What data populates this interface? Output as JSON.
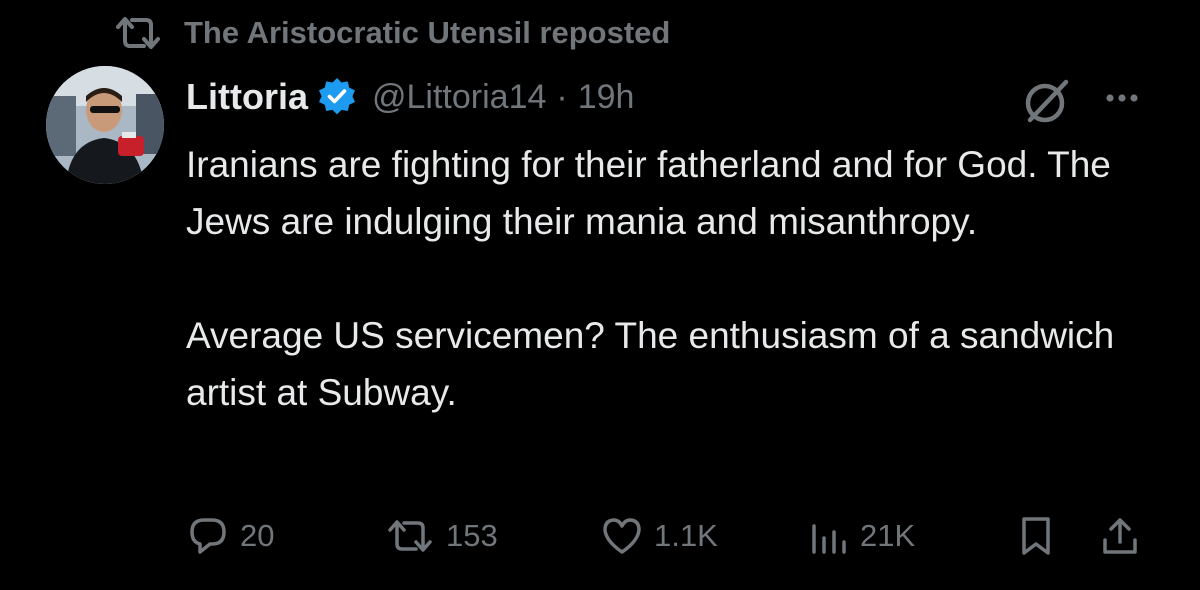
{
  "repost_banner": {
    "text": "The Aristocratic Utensil reposted",
    "icon": "repost-icon"
  },
  "tweet": {
    "author": {
      "display_name": "Littoria",
      "handle": "@Littoria14",
      "verified": true,
      "verified_color": "#1d9bf0",
      "avatar": "profile-photo"
    },
    "separator": "·",
    "time": "19h",
    "text": "Iranians are fighting for their fatherland and for God. The Jews are indulging their mania and misanthropy.\n\nAverage US servicemen? The enthusiasm of a sandwich artist at Subway.",
    "actions": {
      "replies": "20",
      "reposts": "153",
      "likes": "1.1K",
      "views": "21K"
    }
  },
  "colors": {
    "background": "#000000",
    "primary_text": "#e7e9ea",
    "secondary_text": "#71767b",
    "accent": "#1d9bf0"
  },
  "icons": [
    "repost-icon",
    "verified-badge-icon",
    "grok-icon",
    "more-options-icon",
    "reply-icon",
    "repost-icon",
    "like-icon",
    "views-icon",
    "bookmark-icon",
    "share-icon"
  ]
}
